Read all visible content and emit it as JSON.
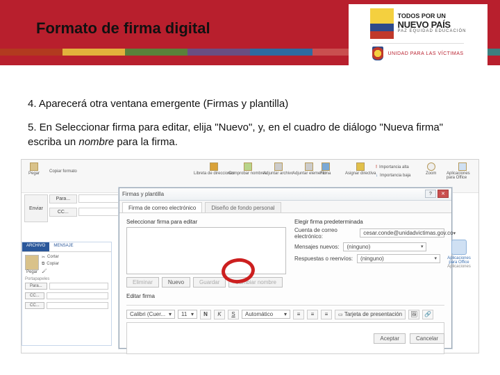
{
  "header": {
    "title": "Formato de firma digital",
    "stripe_colors": [
      "#b23a1f",
      "#e2b23c",
      "#5a813a",
      "#6a4e82",
      "#2e6aa0",
      "#c94f4f",
      "#87a24a",
      "#3c7f7f"
    ],
    "logo": {
      "line1": "TODOS POR UN",
      "line2": "NUEVO PAÍS",
      "tagline": "PAZ  EQUIDAD  EDUCACIÓN",
      "unidad": "UNIDAD PARA LAS VÍCTIMAS",
      "unidad_bold": "LAS VÍCTIMAS"
    }
  },
  "steps": {
    "s4": "4. Aparecerá otra ventana emergente (Firmas y plantilla)",
    "s5_a": "5. En Seleccionar firma para editar, elija \"Nuevo\", y, en el cuadro de diálogo \"Nueva firma\" escriba un ",
    "s5_em": "nombre",
    "s5_b": " para la firma."
  },
  "ribbon": {
    "items": [
      "Pegar",
      "Copiar formato",
      "Libreta de direcciones",
      "Comprobar nombres",
      "Adjuntar archivo",
      "Adjuntar elemento",
      "Firma",
      "Asignar directiva",
      "Importancia alta",
      "Importancia baja",
      "Zoom",
      "Aplicaciones para Office"
    ]
  },
  "compose": {
    "send": "Enviar",
    "para": "Para...",
    "cc": "CC...",
    "cco": "CC..."
  },
  "window2": {
    "tab1": "ARCHIVO",
    "tab2": "MENSAJE",
    "cut": "Cortar",
    "copy": "Copiar",
    "paste": "Pegar",
    "portapapeles": "Portapapeles"
  },
  "dialog": {
    "title": "Firmas y plantilla",
    "tabs": [
      "Firma de correo electrónico",
      "Diseño de fondo personal"
    ],
    "left_label": "Seleccionar firma para editar",
    "buttons": {
      "eliminar": "Eliminar",
      "nuevo": "Nuevo",
      "guardar": "Guardar",
      "cambiar": "Cambiar nombre"
    },
    "right_label": "Elegir firma predeterminada",
    "account_label": "Cuenta de correo electrónico:",
    "account_value": "cesar.conde@unidadvictimas.gov.co",
    "new_msgs_label": "Mensajes nuevos:",
    "new_msgs_value": "(ninguno)",
    "reply_label": "Respuestas o reenvíos:",
    "reply_value": "(ninguno)",
    "edit_label": "Editar firma",
    "font": "Calibri (Cuer...",
    "size": "11",
    "auto": "Automático",
    "bizcard": "Tarjeta de presentación",
    "ok": "Aceptar",
    "cancel": "Cancelar"
  },
  "apps": {
    "label1": "Aplicaciones para Office",
    "label2": "Aplicaciones"
  }
}
